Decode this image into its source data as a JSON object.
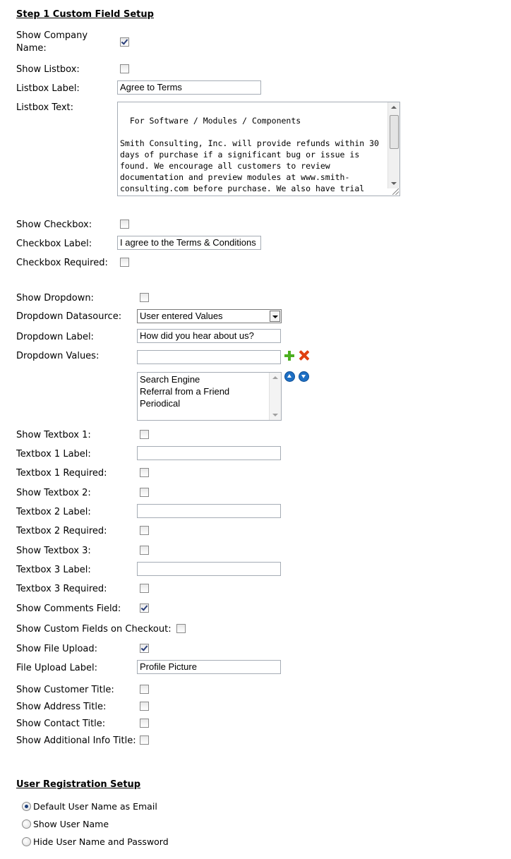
{
  "step1": {
    "title": "Step 1 Custom Field Setup",
    "show_company_name_line1": "Show Company",
    "show_company_name_line2": "Name:",
    "show_listbox": "Show Listbox:",
    "listbox_label": "Listbox Label:",
    "listbox_label_value": "Agree to Terms",
    "listbox_text": "Listbox Text:",
    "listbox_text_value": "For Software / Modules / Components\n\nSmith Consulting, Inc. will provide refunds within 30 days of purchase if a significant bug or issue is found. We encourage all customers to review documentation and preview modules at www.smith-consulting.com before purchase. We also have trial versions for several of our",
    "show_checkbox": "Show Checkbox:",
    "checkbox_label": "Checkbox Label:",
    "checkbox_label_value": "I agree to the Terms & Conditions",
    "checkbox_required": "Checkbox Required:",
    "show_dropdown": "Show Dropdown:",
    "dropdown_datasource": "Dropdown Datasource:",
    "dropdown_datasource_value": "User entered Values",
    "dropdown_label": "Dropdown Label:",
    "dropdown_label_value": "How did you hear about us?",
    "dropdown_values": "Dropdown Values:",
    "dropdown_values_input": "",
    "dropdown_values_list": [
      "Search Engine",
      "Referral from a Friend",
      "Periodical"
    ],
    "show_textbox1": "Show Textbox 1:",
    "textbox1_label": "Textbox 1 Label:",
    "textbox1_required": "Textbox 1 Required:",
    "show_textbox2": "Show Textbox 2:",
    "textbox2_label": "Textbox 2 Label:",
    "textbox2_required": "Textbox 2 Required:",
    "show_textbox3": "Show Textbox 3:",
    "textbox3_label": "Textbox 3 Label:",
    "textbox3_required": "Textbox 3 Required:",
    "show_comments": "Show Comments Field:",
    "show_custom_checkout": "Show Custom Fields on Checkout:",
    "show_file_upload": "Show File Upload:",
    "file_upload_label": "File Upload Label:",
    "file_upload_label_value": "Profile Picture",
    "show_customer_title": "Show Customer Title:",
    "show_address_title": "Show Address Title:",
    "show_contact_title": "Show Contact Title:",
    "show_additional_info_title": "Show Additional Info Title:"
  },
  "registration": {
    "title": "User Registration Setup",
    "options": [
      "Default User Name as Email",
      "Show User Name",
      "Hide User Name and Password"
    ],
    "selected_index": 0
  },
  "icons": {
    "add": "plus-icon",
    "remove": "x-icon",
    "move_up": "arrow-up-icon",
    "move_down": "arrow-down-icon"
  }
}
